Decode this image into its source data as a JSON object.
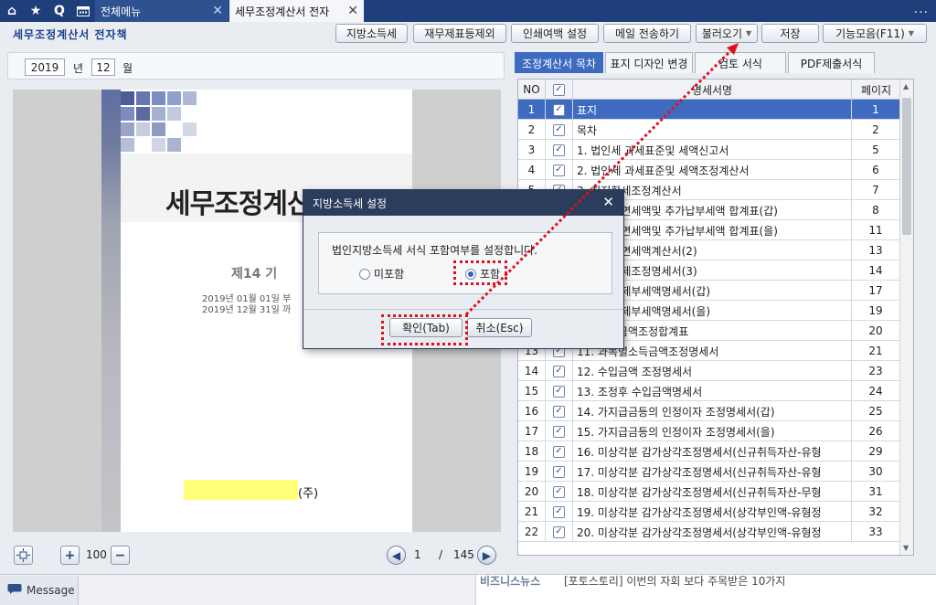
{
  "top_tabs": {
    "menu": "전체메뉴",
    "tax": "세무조정계산서 전자",
    "more": "..."
  },
  "page_title": "세무조정계산서 전자책",
  "toolbar": {
    "local_tax": "지방소득세",
    "fin_exclude": "재무제표등제외",
    "print_margin": "인쇄여백 설정",
    "email": "메일 전송하기",
    "load": "불러오기",
    "save": "저장",
    "functions": "기능모음(F11)"
  },
  "date": {
    "year": "2019",
    "year_unit": "년",
    "month": "12",
    "month_unit": "월"
  },
  "preview": {
    "doc_title": "세무조정계산서",
    "term": "제14 기",
    "period_from": "2019년  01월 01일  부",
    "period_to": "2019년  12월 31일  까",
    "corp_suffix": "(주)",
    "zoom": "100",
    "page_current": "1",
    "page_sep": "/",
    "page_total": "145"
  },
  "right_tabs": [
    "조정계산서 목차",
    "표지 디자인 변경",
    "검토 서식",
    "PDF제출서식"
  ],
  "table": {
    "headers": {
      "no": "NO",
      "name": "명세서명",
      "page": "페이지"
    },
    "rows": [
      {
        "no": "1",
        "name": "표지",
        "page": "1"
      },
      {
        "no": "2",
        "name": "목차",
        "page": "2"
      },
      {
        "no": "3",
        "name": "1. 법인세 과세표준및 세액신고서",
        "page": "5"
      },
      {
        "no": "4",
        "name": "2. 법인세 과세표준및 세액조정계산서",
        "page": "6"
      },
      {
        "no": "5",
        "name": "3. 최저한세조정계산서",
        "page": "7"
      },
      {
        "no": "6",
        "name": "4. 공제감면세액및 추가납부세액 합계표(갑)",
        "page": "8"
      },
      {
        "no": "7",
        "name": "5. 공제감면세액및 추가납부세액 합계표(을)",
        "page": "11"
      },
      {
        "no": "8",
        "name": "6. 공제감면세액계산서(2)",
        "page": "13"
      },
      {
        "no": "9",
        "name": "7. 세액공제조정명세서(3)",
        "page": "14"
      },
      {
        "no": "10",
        "name": "8. 세액공제부세액명세서(갑)",
        "page": "17"
      },
      {
        "no": "11",
        "name": "9. 세액공제부세액명세서(을)",
        "page": "19"
      },
      {
        "no": "12",
        "name": "10. 소득금액조정합계표",
        "page": "20"
      },
      {
        "no": "13",
        "name": "11. 과목별소득금액조정명세서",
        "page": "21"
      },
      {
        "no": "14",
        "name": "12. 수입금액 조정명세서",
        "page": "23"
      },
      {
        "no": "15",
        "name": "13. 조정후 수입금액명세서",
        "page": "24"
      },
      {
        "no": "16",
        "name": "14. 가지급금등의 인정이자 조정명세서(갑)",
        "page": "25"
      },
      {
        "no": "17",
        "name": "15. 가지급금등의 인정이자 조정명세서(을)",
        "page": "26"
      },
      {
        "no": "18",
        "name": "16. 미상각분 감가상각조정명세서(신규취득자산-유형",
        "page": "29"
      },
      {
        "no": "19",
        "name": "17. 미상각분 감가상각조정명세서(신규취득자산-유형",
        "page": "30"
      },
      {
        "no": "20",
        "name": "18. 미상각분 감가상각조정명세서(신규취득자산-무형",
        "page": "31"
      },
      {
        "no": "21",
        "name": "19. 미상각분 감가상각조정명세서(상각부인액-유형정",
        "page": "32"
      },
      {
        "no": "22",
        "name": "20. 미상각분 감가상각조정명세서(상각부인액-유형정",
        "page": "33"
      }
    ]
  },
  "status": {
    "message": "Message",
    "news_category": "비즈니스뉴스",
    "news_text": "[포토스토리] 이번의 자회 보다 주목받은 10가지"
  },
  "modal": {
    "title": "지방소득세 설정",
    "message": "법인지방소득세 서식 포함여부를 설정합니다.",
    "option_exclude": "미포함",
    "option_include": "포함",
    "ok": "확인(Tab)",
    "cancel": "취소(Esc)"
  },
  "colors": {
    "topbar": "#1f3f7a",
    "selection": "#3e6bbf",
    "annotation": "#e0101a",
    "highlight": "#ffff7a"
  }
}
